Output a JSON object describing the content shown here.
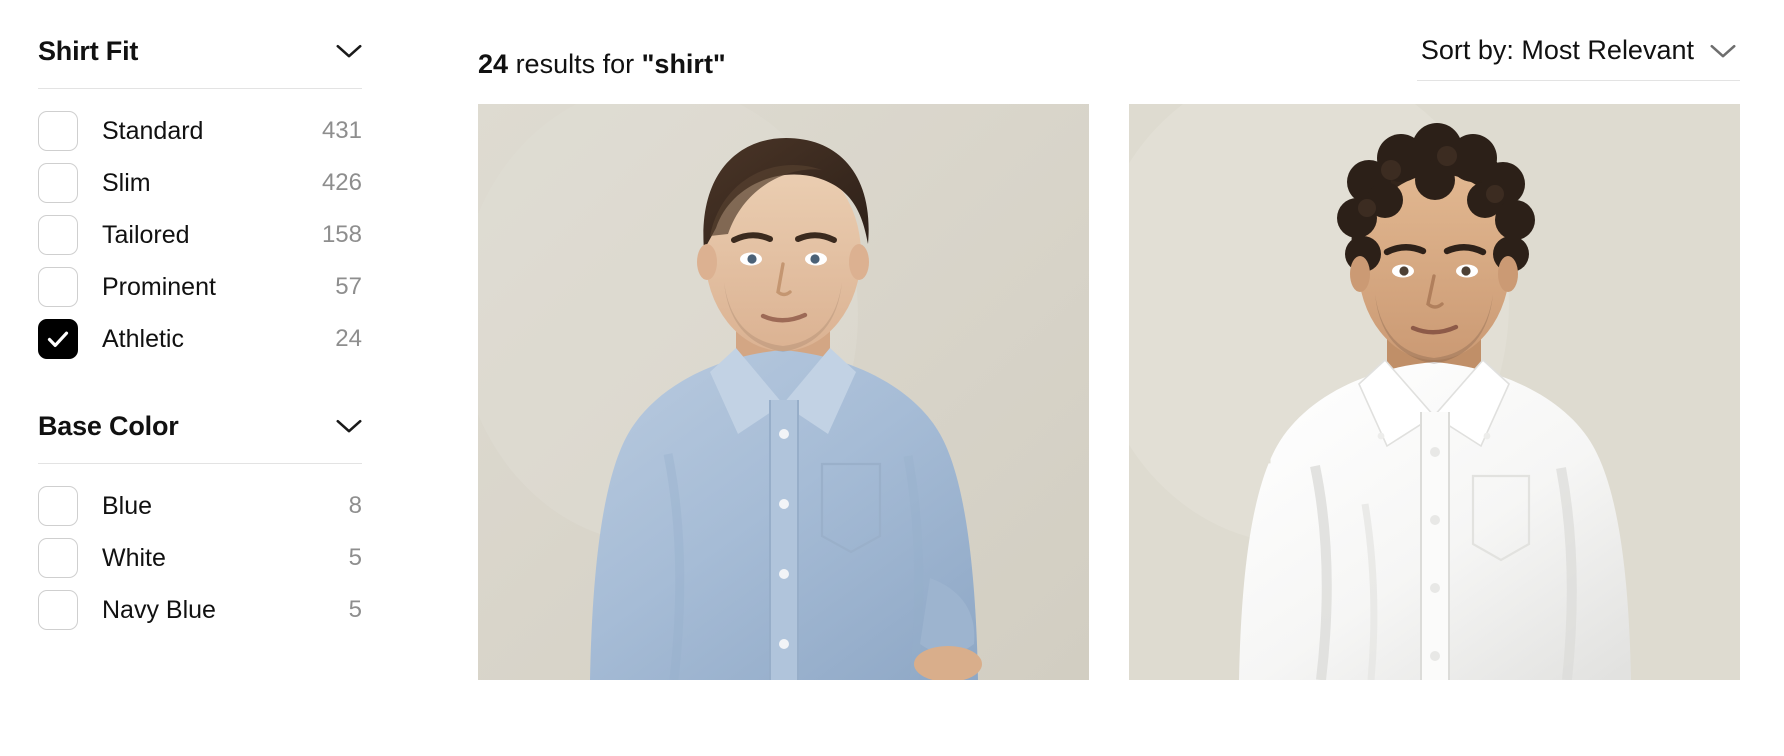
{
  "sidebar": {
    "groups": [
      {
        "title": "Shirt Fit",
        "chevron_icon": "chevron-down-icon",
        "options": [
          {
            "label": "Standard",
            "count": "431",
            "checked": false
          },
          {
            "label": "Slim",
            "count": "426",
            "checked": false
          },
          {
            "label": "Tailored",
            "count": "158",
            "checked": false
          },
          {
            "label": "Prominent",
            "count": "57",
            "checked": false
          },
          {
            "label": "Athletic",
            "count": "24",
            "checked": true
          }
        ]
      },
      {
        "title": "Base Color",
        "chevron_icon": "chevron-down-icon",
        "options": [
          {
            "label": "Blue",
            "count": "8",
            "checked": false
          },
          {
            "label": "White",
            "count": "5",
            "checked": false
          },
          {
            "label": "Navy Blue",
            "count": "5",
            "checked": false
          }
        ]
      }
    ]
  },
  "results": {
    "count": "24",
    "middle_text": "results for",
    "query": "\"shirt\""
  },
  "sort": {
    "label": "Sort by: Most Relevant",
    "chevron_icon": "chevron-down-icon"
  },
  "products": [
    {
      "alt": "Man with short dark wavy hair wearing a light blue oxford button-down shirt",
      "background": "#d9d6cb",
      "shirt_color": "#a9bed6",
      "shirt_shadow": "#8fa9c6",
      "hair_color": "#3a2a20",
      "skin_color": "#e6c2a4"
    },
    {
      "alt": "Man with curly dark hair wearing a white oxford button-down shirt",
      "background": "#dedbd0",
      "shirt_color": "#f7f7f6",
      "shirt_shadow": "#dcdcda",
      "hair_color": "#2b1f18",
      "skin_color": "#d9ab85"
    }
  ],
  "colors": {
    "text": "#111111",
    "muted": "#8e8e8e",
    "divider": "#e3e3e3",
    "checkbox_border": "#cfcfcf",
    "checkbox_checked": "#000000"
  }
}
